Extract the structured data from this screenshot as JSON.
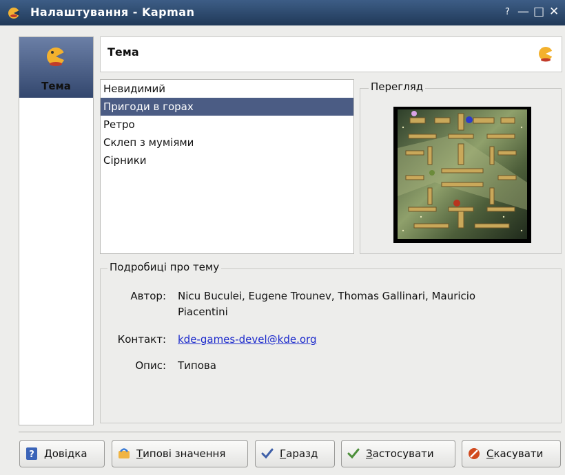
{
  "window": {
    "title": "Налаштування - Kapman",
    "help_symbol": "?",
    "minimize_symbol": "—",
    "maximize_symbol": "□",
    "close_symbol": "✕"
  },
  "sidebar": {
    "items": [
      {
        "label": "Тема",
        "icon": "kapman-icon"
      }
    ]
  },
  "header": {
    "title": "Тема",
    "icon": "kapman-icon"
  },
  "themes": {
    "items": [
      "Невидимий",
      "Пригоди в горах",
      "Ретро",
      "Склеп з муміями",
      "Сірники"
    ],
    "selected_index": 1
  },
  "preview": {
    "title": "Перегляд"
  },
  "details": {
    "title": "Подробиці про тему",
    "author_label": "Автор:",
    "author_line1": "Nicu Buculei, Eugene Trounev, Thomas Gallinari, Mauricio",
    "author_line2": "Piacentini",
    "contact_label": "Контакт:",
    "contact_value": "kde-games-devel@kde.org",
    "description_label": "Опис:",
    "description_value": "Типова"
  },
  "buttons": {
    "help": "Довідка",
    "defaults": "Типові значення",
    "ok": "Гаразд",
    "apply": "Застосувати",
    "cancel": "Скасувати"
  },
  "colors": {
    "titlebar": "#2b4a73",
    "selection": "#4b5c84",
    "link": "#1d2bcc"
  }
}
